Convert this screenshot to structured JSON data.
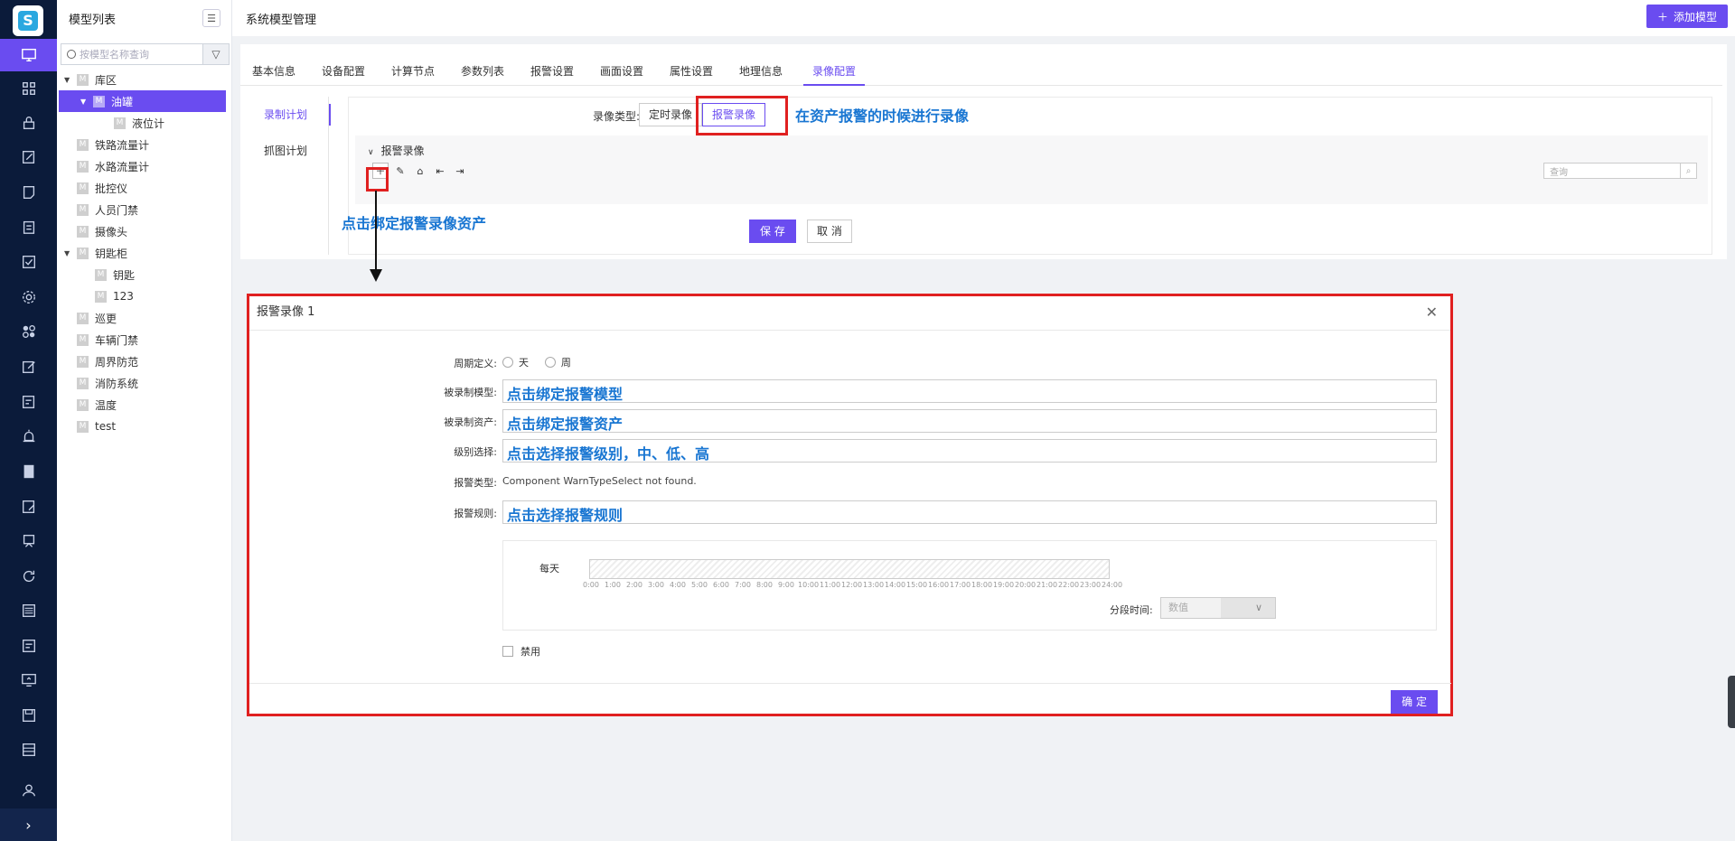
{
  "tree": {
    "title": "模型列表",
    "search_placeholder": "按模型名称查询",
    "nodes": [
      {
        "label": "库区",
        "m": "M"
      },
      {
        "label": "油罐",
        "m": "M"
      },
      {
        "label": "液位计",
        "m": "M"
      },
      {
        "label": "铁路流量计",
        "m": "M"
      },
      {
        "label": "水路流量计",
        "m": "M"
      },
      {
        "label": "批控仪",
        "m": "M"
      },
      {
        "label": "人员门禁",
        "m": "M"
      },
      {
        "label": "摄像头",
        "m": "M"
      },
      {
        "label": "钥匙柜",
        "m": "M"
      },
      {
        "label": "钥匙",
        "m": "M"
      },
      {
        "label": "123",
        "m": "M"
      },
      {
        "label": "巡更",
        "m": "M"
      },
      {
        "label": "车辆门禁",
        "m": "M"
      },
      {
        "label": "周界防范",
        "m": "M"
      },
      {
        "label": "消防系统",
        "m": "M"
      },
      {
        "label": "温度",
        "m": "M"
      },
      {
        "label": "test",
        "m": "M"
      }
    ]
  },
  "header": {
    "title": "系统模型管理",
    "add_button": "添加模型"
  },
  "tabs": [
    "基本信息",
    "设备配置",
    "计算节点",
    "参数列表",
    "报警设置",
    "画面设置",
    "属性设置",
    "地理信息",
    "录像配置"
  ],
  "subnav": [
    "录制计划",
    "抓图计划"
  ],
  "recording": {
    "type_label": "录像类型:",
    "type_timed": "定时录像",
    "type_alarm": "报警录像",
    "section_title": "报警录像",
    "search_placeholder": "查询",
    "save": "保 存",
    "cancel": "取 消"
  },
  "annotations": {
    "alarm_recording_note": "在资产报警的时候进行录像",
    "bind_asset_note": "点击绑定报警录像资产"
  },
  "dialog": {
    "title": "报警录像 1",
    "cycle_label": "周期定义:",
    "cycle_day": "天",
    "cycle_week": "周",
    "model_label": "被录制模型:",
    "model_hint": "点击绑定报警模型",
    "asset_label": "被录制资产:",
    "asset_hint": "点击绑定报警资产",
    "level_label": "级别选择:",
    "level_hint": "点击选择报警级别，中、低、高",
    "alarm_type_label": "报警类型:",
    "alarm_type_value": "Component WarnTypeSelect not found.",
    "rule_label": "报警规则:",
    "rule_hint": "点击选择报警规则",
    "day_label": "每天",
    "hours": [
      "0:00",
      "1:00",
      "2:00",
      "3:00",
      "4:00",
      "5:00",
      "6:00",
      "7:00",
      "8:00",
      "9:00",
      "10:00",
      "11:00",
      "12:00",
      "13:00",
      "14:00",
      "15:00",
      "16:00",
      "17:00",
      "18:00",
      "19:00",
      "20:00",
      "21:00",
      "22:00",
      "23:00",
      "24:00"
    ],
    "segment_label": "分段时间:",
    "segment_placeholder": "数值",
    "disable_label": "禁用",
    "confirm": "确 定"
  },
  "colors": {
    "accent": "#6a4cf0",
    "rail": "#0b1b3a",
    "annotation": "#1976d2",
    "highlight_box": "#e02020"
  }
}
